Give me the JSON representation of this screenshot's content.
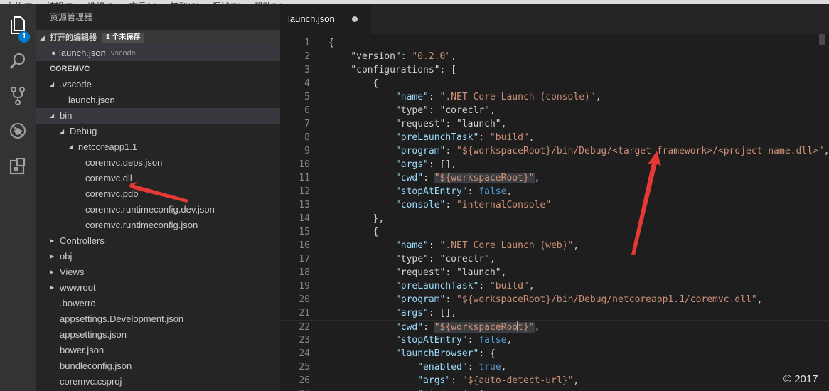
{
  "menubar": {
    "items": [
      "文件(F)",
      "编辑(E)",
      "选择(S)",
      "查看(V)",
      "转到(G)",
      "调试(D)",
      "帮助(H)"
    ]
  },
  "activity_bar": {
    "items": [
      {
        "icon": "files-icon",
        "badge": "1"
      },
      {
        "icon": "search-icon"
      },
      {
        "icon": "source-control-icon"
      },
      {
        "icon": "debug-icon"
      },
      {
        "icon": "extensions-icon"
      }
    ]
  },
  "sidebar": {
    "title": "资源管理器",
    "open_editors": {
      "label": "打开的编辑器",
      "unsaved_badge": "1 个未保存",
      "file_name": "launch.json",
      "file_dir": ".vscode"
    },
    "project": {
      "label": "COREMVC",
      "tree": [
        {
          "label": ".vscode",
          "indent": 1,
          "twisty": "open"
        },
        {
          "label": "launch.json",
          "indent": 2,
          "twisty": "none"
        },
        {
          "label": "bin",
          "indent": 1,
          "twisty": "open",
          "selected": true
        },
        {
          "label": "Debug",
          "indent": 2,
          "twisty": "open"
        },
        {
          "label": "netcoreapp1.1",
          "indent": 3,
          "twisty": "open"
        },
        {
          "label": "coremvc.deps.json",
          "indent": 4,
          "twisty": "none"
        },
        {
          "label": "coremvc.dll",
          "indent": 4,
          "twisty": "none"
        },
        {
          "label": "coremvc.pdb",
          "indent": 4,
          "twisty": "none"
        },
        {
          "label": "coremvc.runtimeconfig.dev.json",
          "indent": 4,
          "twisty": "none"
        },
        {
          "label": "coremvc.runtimeconfig.json",
          "indent": 4,
          "twisty": "none"
        },
        {
          "label": "Controllers",
          "indent": 1,
          "twisty": "closed"
        },
        {
          "label": "obj",
          "indent": 1,
          "twisty": "closed"
        },
        {
          "label": "Views",
          "indent": 1,
          "twisty": "closed"
        },
        {
          "label": "wwwroot",
          "indent": 1,
          "twisty": "closed"
        },
        {
          "label": ".bowerrc",
          "indent": 1,
          "twisty": "none"
        },
        {
          "label": "appsettings.Development.json",
          "indent": 1,
          "twisty": "none"
        },
        {
          "label": "appsettings.json",
          "indent": 1,
          "twisty": "none"
        },
        {
          "label": "bower.json",
          "indent": 1,
          "twisty": "none"
        },
        {
          "label": "bundleconfig.json",
          "indent": 1,
          "twisty": "none"
        },
        {
          "label": "coremvc.csproj",
          "indent": 1,
          "twisty": "none"
        }
      ]
    }
  },
  "editor": {
    "tab": {
      "title": "launch.json",
      "dirty": true
    },
    "current_line": 22,
    "lines": [
      {
        "n": "1",
        "toks": [
          [
            "p",
            "{"
          ]
        ]
      },
      {
        "n": "2",
        "toks": [
          [
            "p",
            "    \"version\": "
          ],
          [
            "s",
            "\"0.2.0\""
          ],
          [
            "p",
            ","
          ]
        ]
      },
      {
        "n": "3",
        "toks": [
          [
            "p",
            "    \"configurations\": ["
          ]
        ]
      },
      {
        "n": "4",
        "toks": [
          [
            "p",
            "        {"
          ]
        ]
      },
      {
        "n": "5",
        "toks": [
          [
            "p",
            "            "
          ],
          [
            "k",
            "\"name\""
          ],
          [
            "p",
            ": "
          ],
          [
            "s",
            "\".NET Core Launch (console)\""
          ],
          [
            "p",
            ","
          ]
        ]
      },
      {
        "n": "6",
        "toks": [
          [
            "p",
            "            \"type\": \"coreclr\","
          ]
        ]
      },
      {
        "n": "7",
        "toks": [
          [
            "p",
            "            \"request\": \"launch\","
          ]
        ]
      },
      {
        "n": "8",
        "toks": [
          [
            "p",
            "            "
          ],
          [
            "k",
            "\"preLaunchTask\""
          ],
          [
            "p",
            ": "
          ],
          [
            "s",
            "\"build\""
          ],
          [
            "p",
            ","
          ]
        ]
      },
      {
        "n": "9",
        "toks": [
          [
            "p",
            "            "
          ],
          [
            "k",
            "\"program\""
          ],
          [
            "p",
            ": "
          ],
          [
            "s",
            "\"${workspaceRoot}/bin/Debug/<target-framework>/<project-name.dll>\""
          ],
          [
            "p",
            ","
          ]
        ]
      },
      {
        "n": "10",
        "toks": [
          [
            "p",
            "            "
          ],
          [
            "k",
            "\"args\""
          ],
          [
            "p",
            ": [],"
          ]
        ]
      },
      {
        "n": "11",
        "toks": [
          [
            "p",
            "            "
          ],
          [
            "k",
            "\"cwd\""
          ],
          [
            "p",
            ": "
          ],
          [
            "sh",
            "\"${workspaceRoot}\""
          ],
          [
            "p",
            ","
          ]
        ]
      },
      {
        "n": "12",
        "toks": [
          [
            "p",
            "            "
          ],
          [
            "k",
            "\"stopAtEntry\""
          ],
          [
            "p",
            ": "
          ],
          [
            "b",
            "false"
          ],
          [
            "p",
            ","
          ]
        ]
      },
      {
        "n": "13",
        "toks": [
          [
            "p",
            "            "
          ],
          [
            "k",
            "\"console\""
          ],
          [
            "p",
            ": "
          ],
          [
            "s",
            "\"internalConsole\""
          ]
        ]
      },
      {
        "n": "14",
        "toks": [
          [
            "p",
            "        },"
          ]
        ]
      },
      {
        "n": "15",
        "toks": [
          [
            "p",
            "        {"
          ]
        ]
      },
      {
        "n": "16",
        "toks": [
          [
            "p",
            "            "
          ],
          [
            "k",
            "\"name\""
          ],
          [
            "p",
            ": "
          ],
          [
            "s",
            "\".NET Core Launch (web)\""
          ],
          [
            "p",
            ","
          ]
        ]
      },
      {
        "n": "17",
        "toks": [
          [
            "p",
            "            \"type\": \"coreclr\","
          ]
        ]
      },
      {
        "n": "18",
        "toks": [
          [
            "p",
            "            \"request\": \"launch\","
          ]
        ]
      },
      {
        "n": "19",
        "toks": [
          [
            "p",
            "            "
          ],
          [
            "k",
            "\"preLaunchTask\""
          ],
          [
            "p",
            ": "
          ],
          [
            "s",
            "\"build\""
          ],
          [
            "p",
            ","
          ]
        ]
      },
      {
        "n": "20",
        "toks": [
          [
            "p",
            "            "
          ],
          [
            "k",
            "\"program\""
          ],
          [
            "p",
            ": "
          ],
          [
            "s",
            "\"${workspaceRoot}/bin/Debug/netcoreapp1.1/coremvc.dll\""
          ],
          [
            "p",
            ","
          ]
        ]
      },
      {
        "n": "21",
        "toks": [
          [
            "p",
            "            "
          ],
          [
            "k",
            "\"args\""
          ],
          [
            "p",
            ": [],"
          ]
        ]
      },
      {
        "n": "22",
        "toks": [
          [
            "p",
            "            "
          ],
          [
            "k",
            "\"cwd\""
          ],
          [
            "p",
            ": "
          ],
          [
            "shc",
            "\"${workspaceRoo"
          ],
          [
            "shc2",
            "t}\""
          ],
          [
            "p",
            ","
          ]
        ]
      },
      {
        "n": "23",
        "toks": [
          [
            "p",
            "            "
          ],
          [
            "k",
            "\"stopAtEntry\""
          ],
          [
            "p",
            ": "
          ],
          [
            "b",
            "false"
          ],
          [
            "p",
            ","
          ]
        ]
      },
      {
        "n": "24",
        "toks": [
          [
            "p",
            "            "
          ],
          [
            "k",
            "\"launchBrowser\""
          ],
          [
            "p",
            ": {"
          ]
        ]
      },
      {
        "n": "25",
        "toks": [
          [
            "p",
            "                "
          ],
          [
            "k",
            "\"enabled\""
          ],
          [
            "p",
            ": "
          ],
          [
            "b",
            "true"
          ],
          [
            "p",
            ","
          ]
        ]
      },
      {
        "n": "26",
        "toks": [
          [
            "p",
            "                "
          ],
          [
            "k",
            "\"args\""
          ],
          [
            "p",
            ": "
          ],
          [
            "s",
            "\"${auto-detect-url}\""
          ],
          [
            "p",
            ","
          ]
        ]
      },
      {
        "n": "27",
        "toks": [
          [
            "p",
            "                "
          ],
          [
            "k",
            "\"windows\""
          ],
          [
            "p",
            ": {"
          ]
        ]
      }
    ]
  },
  "watermark": "© 2017",
  "colors": {
    "annotation_arrow": "#e53935"
  }
}
